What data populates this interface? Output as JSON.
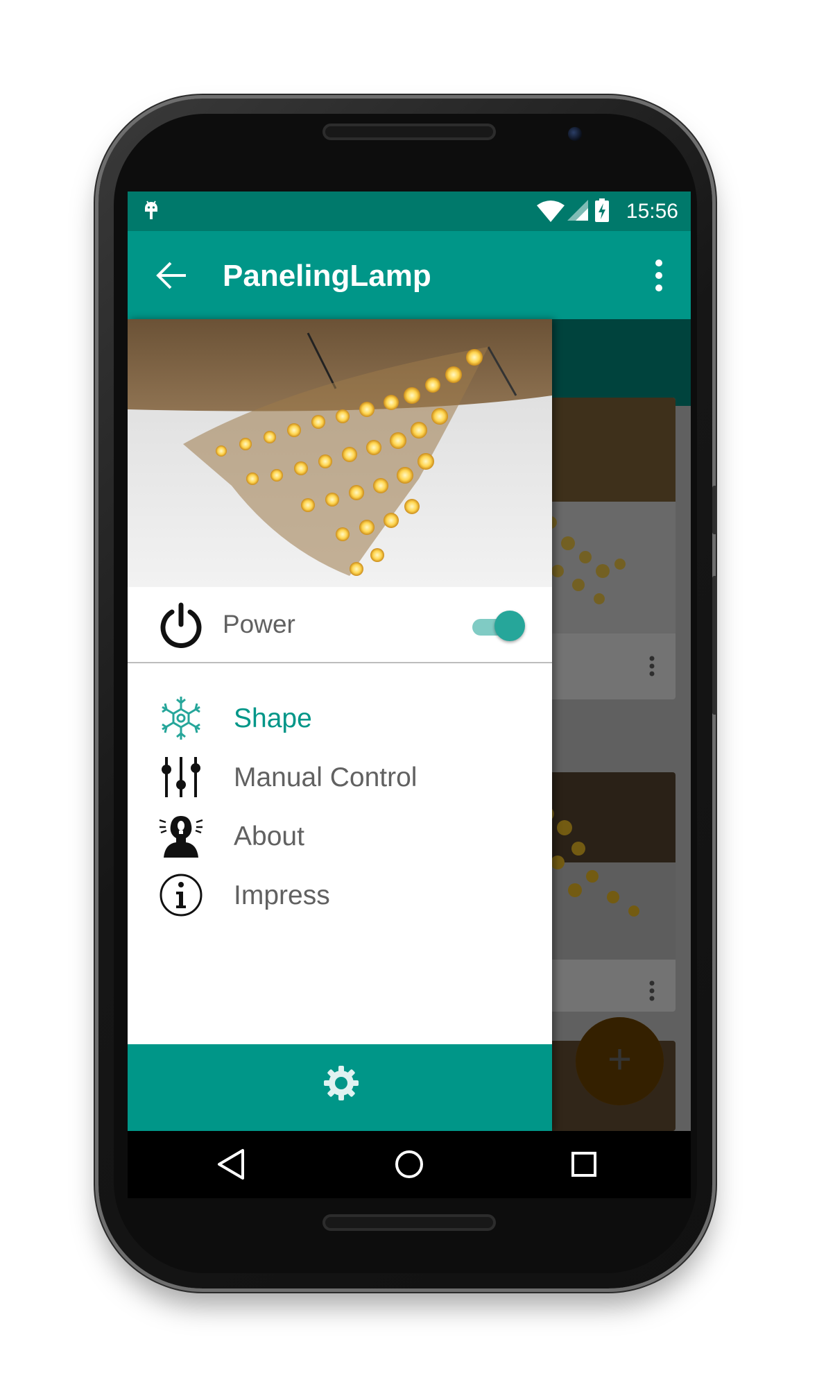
{
  "status_bar": {
    "time": "15:56",
    "icons": [
      "android-notification-icon",
      "wifi-icon",
      "signal-icon",
      "battery-charging-icon"
    ]
  },
  "app_bar": {
    "title": "PanelingLamp",
    "back_icon": "arrow-back-icon",
    "overflow_icon": "more-vert-icon"
  },
  "drawer": {
    "header_image": "lamp-photo",
    "power": {
      "label": "Power",
      "enabled": true
    },
    "items": [
      {
        "label": "Shape",
        "icon": "snowflake-shape-icon",
        "active": true
      },
      {
        "label": "Manual Control",
        "icon": "sliders-icon",
        "active": false
      },
      {
        "label": "About",
        "icon": "person-bulb-icon",
        "active": false
      },
      {
        "label": "Impress",
        "icon": "info-icon",
        "active": false
      }
    ],
    "footer_icon": "gear-icon"
  },
  "fab": {
    "label": "+"
  },
  "colors": {
    "primary": "#009688",
    "primary_dark": "#00796b",
    "accent": "#ffa000",
    "toggle_track": "#80cbc4",
    "text_secondary": "#616161"
  },
  "nav_bar": [
    "back-triangle-icon",
    "home-circle-icon",
    "recents-square-icon"
  ]
}
